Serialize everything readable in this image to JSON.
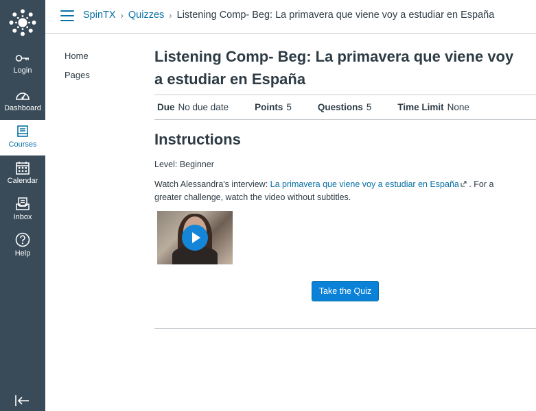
{
  "global_nav": {
    "items": [
      {
        "label": "Login",
        "icon": "key-icon"
      },
      {
        "label": "Dashboard",
        "icon": "dashboard-icon"
      },
      {
        "label": "Courses",
        "icon": "courses-icon",
        "active": true
      },
      {
        "label": "Calendar",
        "icon": "calendar-icon"
      },
      {
        "label": "Inbox",
        "icon": "inbox-icon"
      },
      {
        "label": "Help",
        "icon": "help-icon"
      }
    ],
    "bg_color": "#394b58",
    "active_color": "#0770a3"
  },
  "breadcrumb": {
    "course": "SpinTX",
    "section": "Quizzes",
    "current": "Listening Comp- Beg: La primavera que viene voy a estudiar en España"
  },
  "course_nav": {
    "items": [
      "Home",
      "Pages"
    ]
  },
  "quiz": {
    "title": "Listening Comp- Beg: La primavera que viene voy a estudiar en España",
    "details": {
      "due_label": "Due",
      "due_value": "No due date",
      "points_label": "Points",
      "points_value": "5",
      "questions_label": "Questions",
      "questions_value": "5",
      "time_limit_label": "Time Limit",
      "time_limit_value": "None"
    },
    "instructions_heading": "Instructions",
    "level_text": "Level: Beginner",
    "watch_prefix": "Watch Alessandra's interview: ",
    "watch_link": "La primavera que viene voy a estudiar en España",
    "watch_suffix": " . For a greater challenge, watch the video without subtitles.",
    "take_quiz_label": "Take the Quiz"
  },
  "colors": {
    "link": "#0770a3",
    "button": "#0b82d8"
  }
}
